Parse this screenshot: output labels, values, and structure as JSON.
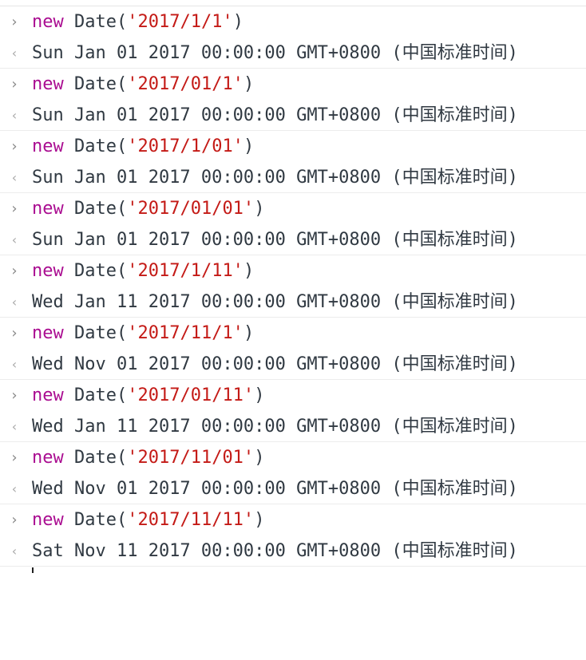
{
  "prompt_in": "›",
  "prompt_out": "‹",
  "entries": [
    {
      "kw": "new",
      "fn": " Date(",
      "arg": "'2017/1/1'",
      "close": ")",
      "result": "Sun Jan 01 2017 00:00:00 GMT+0800 (中国标准时间)"
    },
    {
      "kw": "new",
      "fn": " Date(",
      "arg": "'2017/01/1'",
      "close": ")",
      "result": "Sun Jan 01 2017 00:00:00 GMT+0800 (中国标准时间)"
    },
    {
      "kw": "new",
      "fn": " Date(",
      "arg": "'2017/1/01'",
      "close": ")",
      "result": "Sun Jan 01 2017 00:00:00 GMT+0800 (中国标准时间)"
    },
    {
      "kw": "new",
      "fn": " Date(",
      "arg": "'2017/01/01'",
      "close": ")",
      "result": "Sun Jan 01 2017 00:00:00 GMT+0800 (中国标准时间)"
    },
    {
      "kw": "new",
      "fn": " Date(",
      "arg": "'2017/1/11'",
      "close": ")",
      "result": "Wed Jan 11 2017 00:00:00 GMT+0800 (中国标准时间)"
    },
    {
      "kw": "new",
      "fn": " Date(",
      "arg": "'2017/11/1'",
      "close": ")",
      "result": "Wed Nov 01 2017 00:00:00 GMT+0800 (中国标准时间)"
    },
    {
      "kw": "new",
      "fn": " Date(",
      "arg": "'2017/01/11'",
      "close": ")",
      "result": "Wed Jan 11 2017 00:00:00 GMT+0800 (中国标准时间)"
    },
    {
      "kw": "new",
      "fn": " Date(",
      "arg": "'2017/11/01'",
      "close": ")",
      "result": "Wed Nov 01 2017 00:00:00 GMT+0800 (中国标准时间)"
    },
    {
      "kw": "new",
      "fn": " Date(",
      "arg": "'2017/11/11'",
      "close": ")",
      "result": "Sat Nov 11 2017 00:00:00 GMT+0800 (中国标准时间)"
    }
  ],
  "colors": {
    "keyword": "#aa0d91",
    "string": "#c41a16",
    "text": "#303942",
    "prompt": "#8a8a8a"
  }
}
